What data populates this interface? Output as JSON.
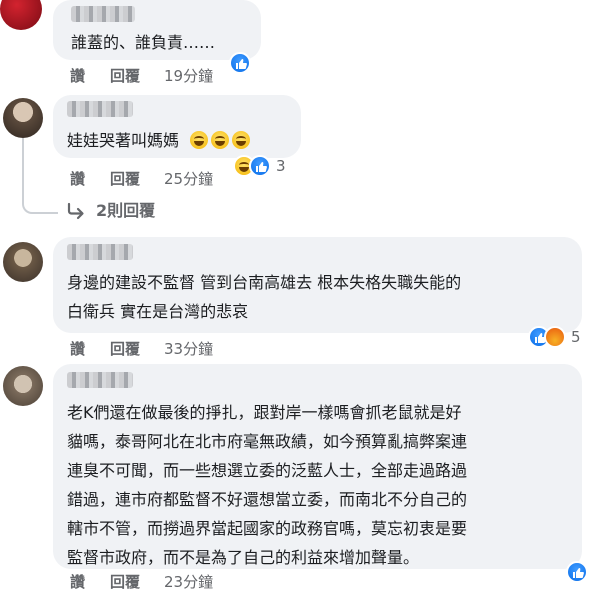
{
  "comments": [
    {
      "text_lines": [
        "誰蓋的、誰負責……"
      ],
      "actions": {
        "like": "讚",
        "reply": "回覆",
        "time": "19分鐘"
      },
      "reaction_count": ""
    },
    {
      "text_lines": [
        "娃娃哭著叫媽媽"
      ],
      "actions": {
        "like": "讚",
        "reply": "回覆",
        "time": "25分鐘"
      },
      "reaction_count": "3",
      "replies_link": "2則回覆"
    },
    {
      "text_lines": [
        "身邊的建設不監督 管到台南高雄去 根本失格失職失能的",
        "白衛兵 實在是台灣的悲哀"
      ],
      "actions": {
        "like": "讚",
        "reply": "回覆",
        "time": "33分鐘"
      },
      "reaction_count": "5"
    },
    {
      "text_lines": [
        "老K們還在做最後的掙扎，跟對岸一樣嗎會抓老鼠就是好",
        "貓嗎，泰哥阿北在北市府毫無政績，如今預算亂搞弊案連",
        "連臭不可聞，而一些想選立委的泛藍人士，全部走過路過",
        "錯過，連市府都監督不好還想當立委，而南北不分自己的",
        "轄市不管，而撈過界當起國家的政務官嗎，莫忘初衷是要",
        "監督市政府，而不是為了自己的利益來增加聲量。"
      ],
      "actions": {
        "like": "讚",
        "reply": "回覆",
        "time": "23分鐘"
      },
      "reaction_count": ""
    }
  ],
  "icons": {
    "like": "like-icon",
    "haha": "laughing-emoji-icon",
    "angry": "angry-icon",
    "reply_arrow": "reply-arrow-icon"
  },
  "colors": {
    "bubble": "#f0f2f5",
    "meta": "#65676b",
    "like_blue": "#1877f2"
  }
}
